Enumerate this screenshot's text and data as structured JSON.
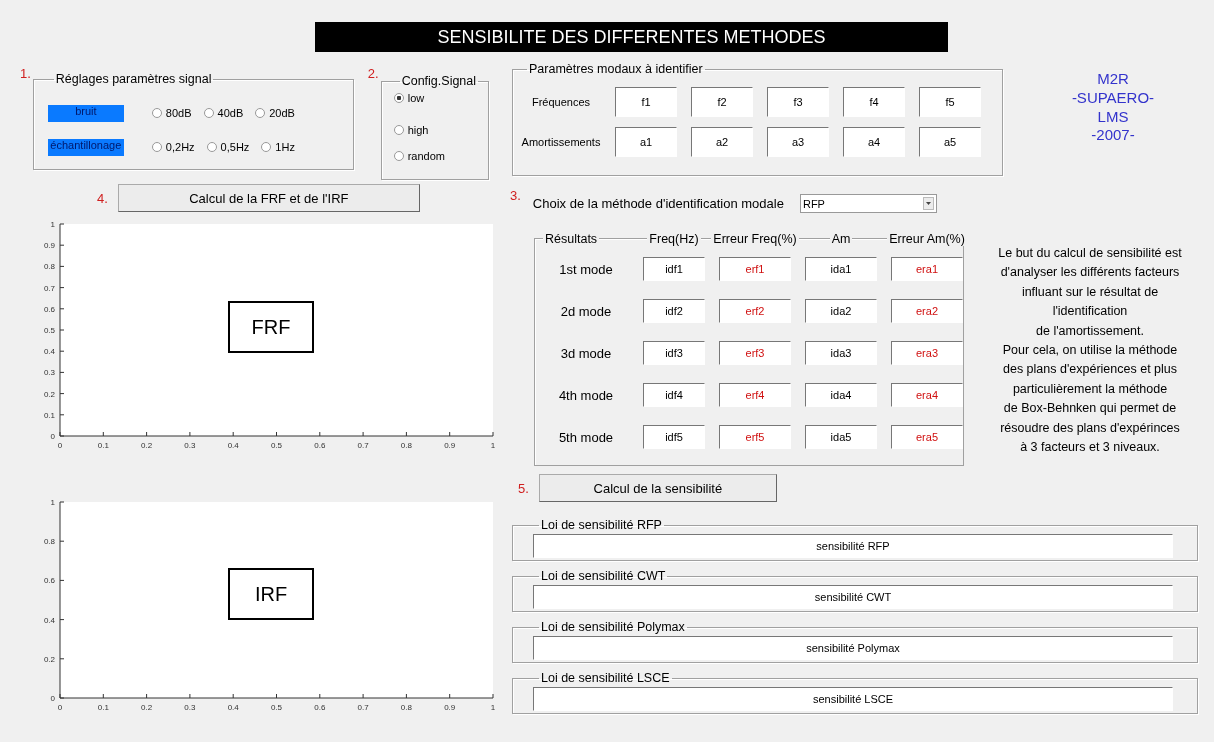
{
  "title": "SENSIBILITE DES DIFFERENTES METHODES",
  "signal_settings": {
    "step": "1.",
    "title": "Réglages paramètres signal",
    "rows": [
      {
        "label": "bruit",
        "options": [
          {
            "label": "80dB",
            "selected": false
          },
          {
            "label": "40dB",
            "selected": false
          },
          {
            "label": "20dB",
            "selected": false
          }
        ]
      },
      {
        "label": "échantillonage",
        "options": [
          {
            "label": "0,2Hz",
            "selected": false
          },
          {
            "label": "0,5Hz",
            "selected": false
          },
          {
            "label": "1Hz",
            "selected": false
          }
        ]
      }
    ]
  },
  "signal_config": {
    "step": "2.",
    "title": "Config.Signal",
    "options": [
      {
        "label": "low",
        "selected": true
      },
      {
        "label": "high",
        "selected": false
      },
      {
        "label": "random",
        "selected": false
      }
    ]
  },
  "frf_button": {
    "step": "4.",
    "label": "Calcul de la FRF et de l'IRF"
  },
  "plots": [
    {
      "label": "FRF",
      "chart_data": {
        "type": "line",
        "xlim": [
          0,
          1
        ],
        "ylim": [
          0,
          1
        ],
        "xticks": [
          0,
          0.1,
          0.2,
          0.3,
          0.4,
          0.5,
          0.6,
          0.7,
          0.8,
          0.9,
          1
        ],
        "yticks": [
          0,
          0.1,
          0.2,
          0.3,
          0.4,
          0.5,
          0.6,
          0.7,
          0.8,
          0.9,
          1
        ]
      }
    },
    {
      "label": "IRF",
      "chart_data": {
        "type": "line",
        "xlim": [
          0,
          1
        ],
        "ylim": [
          0,
          1
        ],
        "xticks": [
          0,
          0.1,
          0.2,
          0.3,
          0.4,
          0.5,
          0.6,
          0.7,
          0.8,
          0.9,
          1
        ],
        "yticks": [
          0,
          0.2,
          0.4,
          0.6,
          0.8,
          1
        ]
      }
    }
  ],
  "modal_params": {
    "title": "Paramètres modaux à identifier",
    "rows": [
      {
        "label": "Fréquences",
        "values": [
          "f1",
          "f2",
          "f3",
          "f4",
          "f5"
        ]
      },
      {
        "label": "Amortissements",
        "values": [
          "a1",
          "a2",
          "a3",
          "a4",
          "a5"
        ]
      }
    ]
  },
  "credits": "M2R\n-SUPAERO-\nLMS\n-2007-",
  "method": {
    "step": "3.",
    "label": "Choix de la méthode d'identification modale",
    "value": "RFP"
  },
  "results": {
    "title": "Résultats",
    "columns": [
      {
        "header": "Freq(Hz)",
        "kind": "value"
      },
      {
        "header": "Erreur Freq(%)",
        "kind": "error"
      },
      {
        "header": "Am",
        "kind": "value"
      },
      {
        "header": "Erreur Am(%)",
        "kind": "error"
      }
    ],
    "rows": [
      {
        "label": "1st mode",
        "cells": [
          "idf1",
          "erf1",
          "ida1",
          "era1"
        ]
      },
      {
        "label": "2d mode",
        "cells": [
          "idf2",
          "erf2",
          "ida2",
          "era2"
        ]
      },
      {
        "label": "3d mode",
        "cells": [
          "idf3",
          "erf3",
          "ida3",
          "era3"
        ]
      },
      {
        "label": "4th mode",
        "cells": [
          "idf4",
          "erf4",
          "ida4",
          "era4"
        ]
      },
      {
        "label": "5th mode",
        "cells": [
          "idf5",
          "erf5",
          "ida5",
          "era5"
        ]
      }
    ]
  },
  "description": "Le but du calcul de sensibilité est\nd'analyser les différents facteurs\ninfluant sur le résultat de\nl'identification\nde l'amortissement.\nPour cela, on utilise la méthode\ndes plans d'expériences et plus\nparticulièrement la méthode\nde Box-Behnken qui permet de\nrésoudre des plans d'expérinces\nà 3 facteurs et 3 niveaux.",
  "sensitivity_button": {
    "step": "5.",
    "label": "Calcul de la sensibilité"
  },
  "sensitivity_laws": [
    {
      "title": "Loi de sensibilité RFP",
      "value": "sensibilité RFP"
    },
    {
      "title": "Loi de sensibilité CWT",
      "value": "sensibilité CWT"
    },
    {
      "title": "Loi de sensibilité Polymax",
      "value": "sensibilité Polymax"
    },
    {
      "title": "Loi de sensibilité LSCE",
      "value": "sensibilité LSCE"
    }
  ]
}
